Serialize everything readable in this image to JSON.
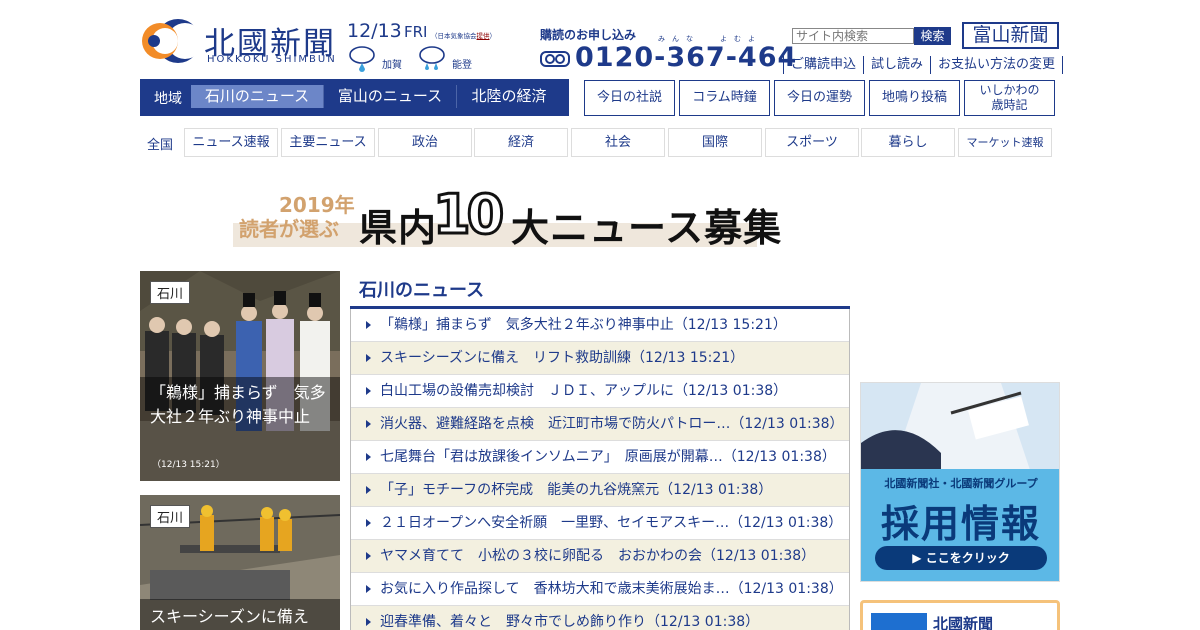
{
  "header": {
    "logo_title": "北國新聞",
    "logo_roman": "HOKKOKU SHIMBUN",
    "weather": {
      "date": "12/13",
      "dow": "FRI",
      "credit_prefix": "（日本気象協会",
      "credit_link": "提供",
      "credit_suffix": "）",
      "areas": [
        {
          "name": "加賀",
          "icon": "rain-cloud-icon"
        },
        {
          "name": "能登",
          "icon": "rain-cloud-icon"
        }
      ]
    },
    "subscribe": {
      "label": "購読のお申し込み",
      "ruby_1": "みんな",
      "ruby_2": "よむよ",
      "phone": "0120-367-464",
      "phone_icon": "free-dial-icon"
    },
    "search": {
      "placeholder": "サイト内検索",
      "button": "検索"
    },
    "toyama_button": "富山新聞",
    "links": [
      "ご購読申込",
      "試し読み",
      "お支払い方法の変更"
    ]
  },
  "region_nav": {
    "label": "地域",
    "tabs": [
      "石川のニュース",
      "富山のニュース",
      "北陸の経済"
    ],
    "active_index": 0
  },
  "feature_buttons": [
    "今日の社説",
    "コラム時鐘",
    "今日の運勢",
    "地鳴り投稿",
    "いしかわの",
    "歳時記"
  ],
  "category_nav": {
    "label": "全国",
    "items": [
      "ニュース速報",
      "主要ニュース",
      "政治",
      "経済",
      "社会",
      "国際",
      "スポーツ",
      "暮らし",
      "マーケット速報"
    ]
  },
  "banner": {
    "year": "2019年",
    "readers": "読者が選ぶ",
    "pre": "県内",
    "ten": "10",
    "post": "大ニュース募集"
  },
  "photos": [
    {
      "tag": "石川",
      "caption": "「鵜様」捕まらず　気多大社２年ぶり神事中止",
      "time": "（12/13 15:21）"
    },
    {
      "tag": "石川",
      "caption": "スキーシーズンに備え"
    }
  ],
  "news": {
    "title": "石川のニュース",
    "items": [
      "「鵜様」捕まらず　気多大社２年ぶり神事中止（12/13 15:21）",
      "スキーシーズンに備え　リフト救助訓練（12/13 15:21）",
      "白山工場の設備売却検討　ＪＤＩ、アップルに（12/13 01:38）",
      "消火器、避難経路を点検　近江町市場で防火パトロー…（12/13 01:38）",
      "七尾舞台「君は放課後インソムニア」　原画展が開幕…（12/13 01:38）",
      "「子」モチーフの杯完成　能美の九谷焼窯元（12/13 01:38）",
      "２１日オープンへ安全祈願　一里野、セイモアスキー…（12/13 01:38）",
      "ヤマメ育てて　小松の３校に卵配る　おおかわの会（12/13 01:38）",
      "お気に入り作品探して　香林坊大和で歳末美術展始ま…（12/13 01:38）",
      "迎春準備、着々と　野々市でしめ飾り作り（12/13 01:38）"
    ]
  },
  "ads": {
    "recruit_sub": "北國新聞社・北國新聞グループ",
    "recruit_main": "採用情報",
    "recruit_button": "▶ ここをクリック",
    "paper_label": "北國新聞"
  },
  "colors": {
    "brand": "#1e3a8a",
    "active_tab": "#6c86c8",
    "stripe": "#f3f0e0",
    "banner_gold": "#d2a26e",
    "ad_blue": "#5cb8e6"
  }
}
